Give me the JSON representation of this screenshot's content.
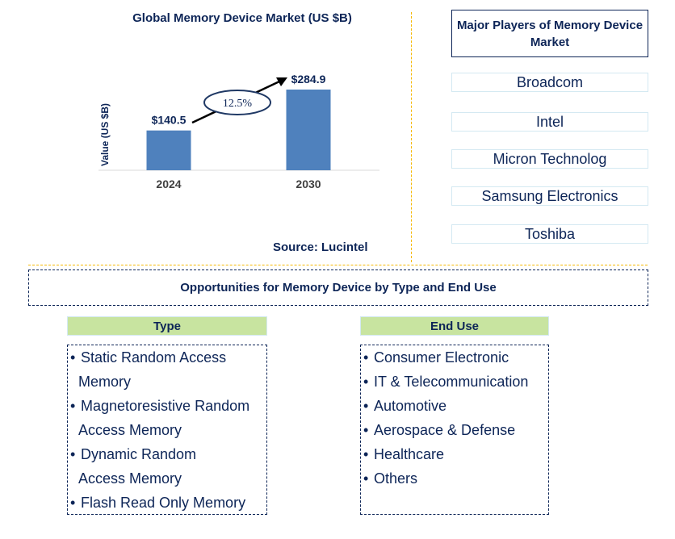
{
  "chart_data": {
    "type": "bar",
    "title": "Global Memory Device Market (US $B)",
    "xlabel": "",
    "ylabel": "Value (US $B)",
    "categories": [
      "2024",
      "2030"
    ],
    "values": [
      140.5,
      284.9
    ],
    "data_labels": [
      "$140.5",
      "$284.9"
    ],
    "annotation": "12.5%",
    "bar_color": "#4f81bd",
    "ylim": [
      0,
      300
    ],
    "grid": false
  },
  "source": "Source: Lucintel",
  "players": {
    "title": "Major Players of Memory Device Market",
    "items": [
      "Broadcom",
      "Intel",
      "Micron Technolog",
      "Samsung Electronics",
      "Toshiba"
    ]
  },
  "opportunities": {
    "title": "Opportunities for Memory Device by Type and End Use",
    "type": {
      "heading": "Type",
      "items": [
        {
          "line1": "Static Random Access",
          "line2": "Memory"
        },
        {
          "line1": "Magnetoresistive Random",
          "line2": "Access Memory"
        },
        {
          "line1": "Dynamic Random",
          "line2": "Access Memory"
        },
        {
          "line1": "Flash Read Only Memory",
          "line2": ""
        }
      ]
    },
    "end_use": {
      "heading": "End Use",
      "items": [
        "Consumer Electronic",
        "IT & Telecommunication",
        "Automotive",
        "Aerospace & Defense",
        "Healthcare",
        "Others"
      ]
    }
  },
  "colors": {
    "text": "#0d2557",
    "bar": "#4f81bd",
    "header_fill": "#c8e4a0",
    "divider": "#f5b800"
  }
}
